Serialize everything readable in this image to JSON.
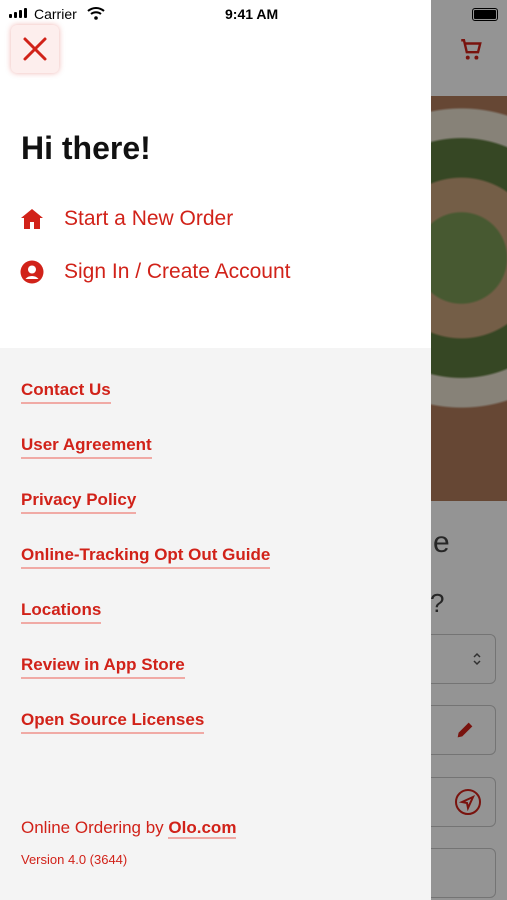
{
  "status_bar": {
    "carrier": "Carrier",
    "time": "9:41 AM"
  },
  "drawer": {
    "greeting": "Hi there!",
    "main_links": [
      {
        "label": "Start a New Order",
        "icon": "home-icon"
      },
      {
        "label": "Sign In / Create Account",
        "icon": "user-circle-icon"
      }
    ],
    "footer_links": [
      "Contact Us",
      "User Agreement",
      "Privacy Policy",
      "Online-Tracking Opt Out Guide",
      "Locations",
      "Review in App Store",
      "Open Source Licenses"
    ],
    "powered_by_prefix": "Online Ordering by",
    "powered_by_link": "Olo.com",
    "version": "Version 4.0 (3644)"
  },
  "colors": {
    "accent": "#d12219",
    "drawer_bg": "#f4f4f4",
    "underline": "#f0aaa5"
  }
}
